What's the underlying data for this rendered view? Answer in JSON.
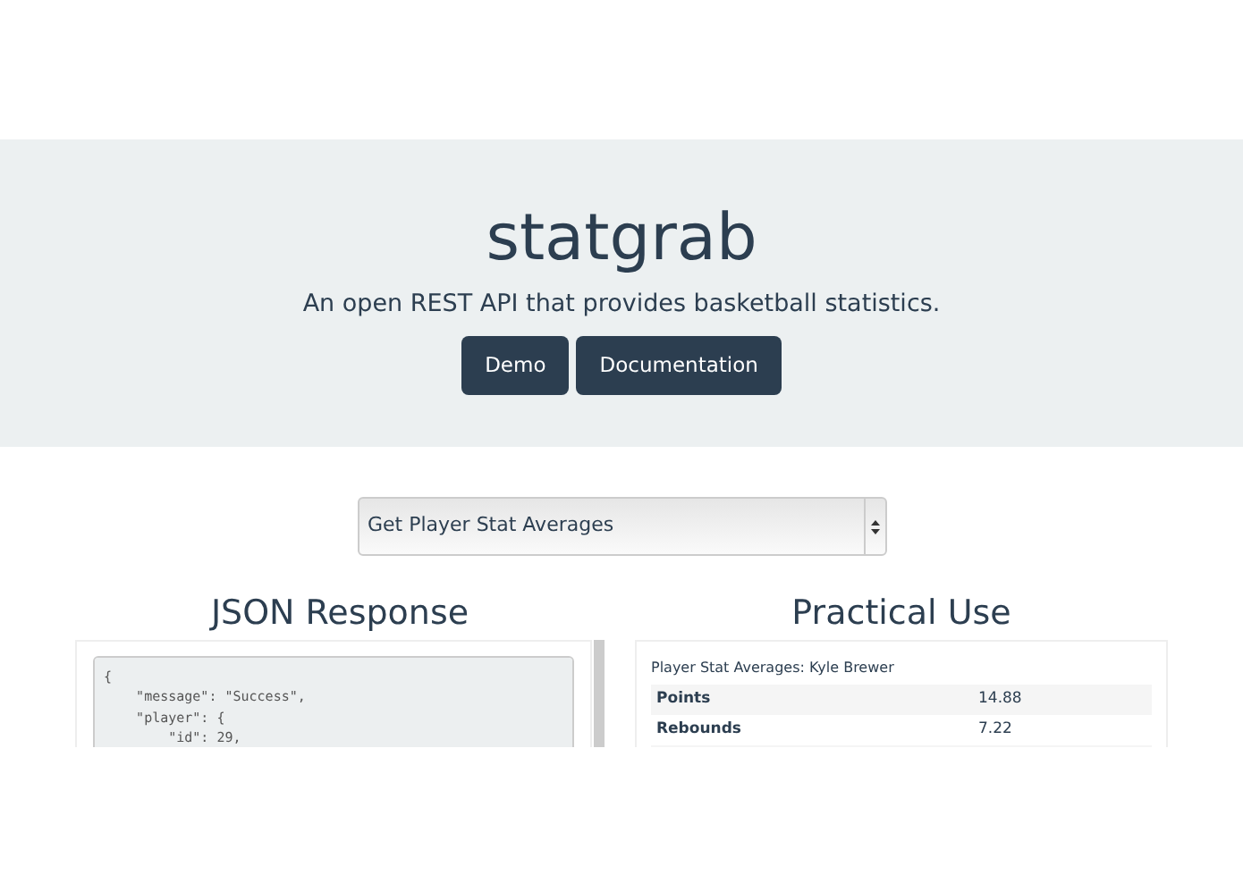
{
  "hero": {
    "title": "statgrab",
    "subtitle": "An open REST API that provides basketball statistics.",
    "buttons": [
      "Demo",
      "Documentation"
    ]
  },
  "endpoint_select": {
    "value": "Get Player Stat Averages"
  },
  "json_response": {
    "heading": "JSON Response",
    "lines": [
      "{",
      "    \"message\": \"Success\",",
      "    \"player\": {",
      "        \"id\": 29,"
    ]
  },
  "practical_use": {
    "heading": "Practical Use",
    "caption": "Player Stat Averages: Kyle Brewer",
    "rows": [
      {
        "stat": "Points",
        "value": "14.88"
      },
      {
        "stat": "Rebounds",
        "value": "7.22"
      }
    ]
  }
}
